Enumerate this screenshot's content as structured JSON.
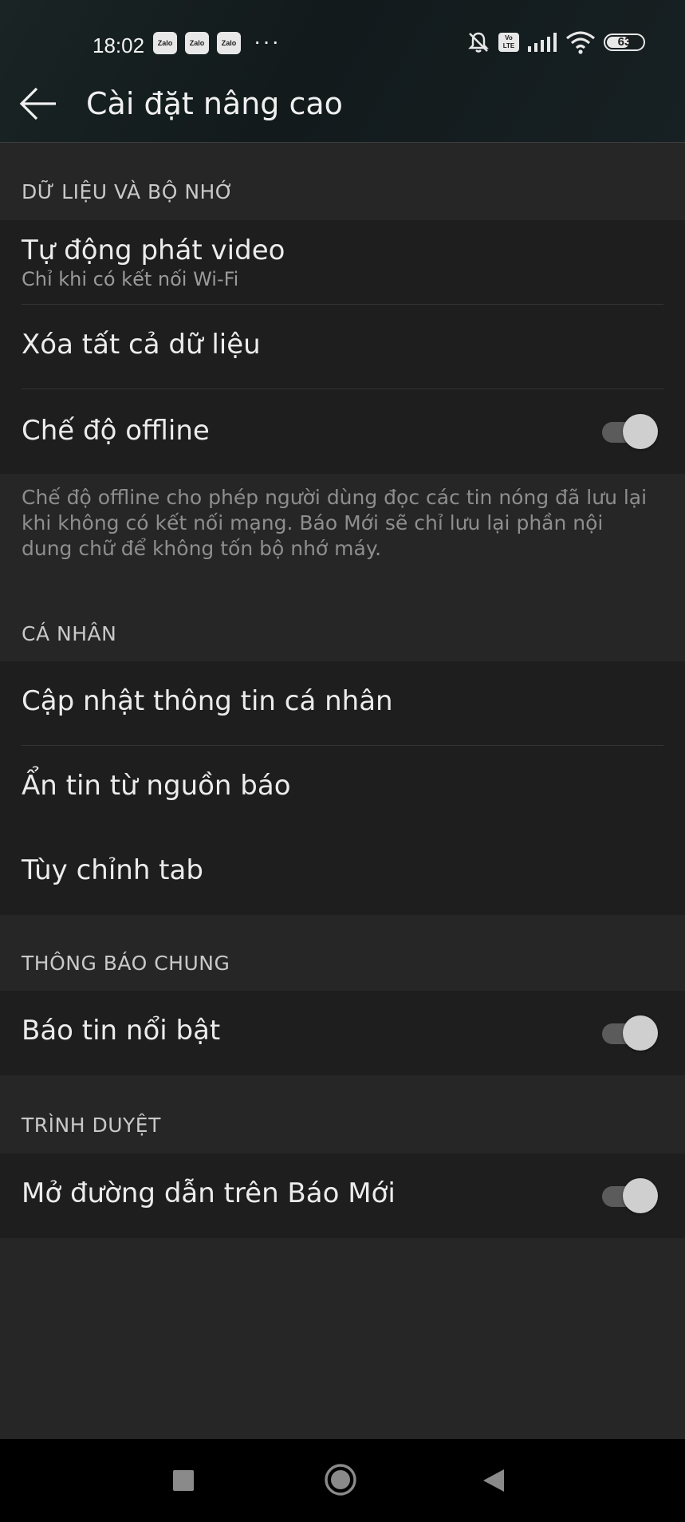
{
  "status_bar": {
    "time": "18:02",
    "notification_apps": [
      "Zalo",
      "Zalo",
      "Zalo"
    ],
    "more": "···",
    "volte_line1": "Vo",
    "volte_line2": "LTE",
    "battery": "63",
    "battery_level": 0.63
  },
  "header": {
    "title": "Cài đặt nâng cao"
  },
  "sections": {
    "data": {
      "label": "DỮ LIỆU VÀ BỘ NHỚ",
      "auto_video": {
        "title": "Tự động phát video",
        "subtitle": "Chỉ khi có kết nối Wi-Fi"
      },
      "clear_data": {
        "title": "Xóa tất cả dữ liệu"
      },
      "offline": {
        "title": "Chế độ offline",
        "enabled": true
      },
      "offline_desc": "Chế độ offline cho phép người dùng đọc các tin nóng đã lưu lại khi không có kết nối mạng. Báo Mới sẽ chỉ lưu lại phần nội dung chữ để không tốn bộ nhớ máy."
    },
    "personal": {
      "label": "CÁ NHÂN",
      "update_info": "Cập nhật thông tin cá nhân",
      "hide_sources": "Ẩn tin từ nguồn báo",
      "customize_tab": "Tùy chỉnh tab"
    },
    "notifications": {
      "label": "THÔNG BÁO CHUNG",
      "highlights": {
        "title": "Báo tin nổi bật",
        "enabled": true
      }
    },
    "browser": {
      "label": "TRÌNH DUYỆT",
      "open_links": {
        "title": "Mở đường dẫn trên Báo Mới",
        "enabled": true
      }
    }
  },
  "nav_bar": {
    "icons": [
      "recent-apps-icon",
      "home-icon",
      "back-icon"
    ]
  },
  "colors": {
    "background": "#262626",
    "group": "#1e1e1e",
    "toggle_knob": "#cfcfcf",
    "toggle_track": "#5b5b5b"
  }
}
